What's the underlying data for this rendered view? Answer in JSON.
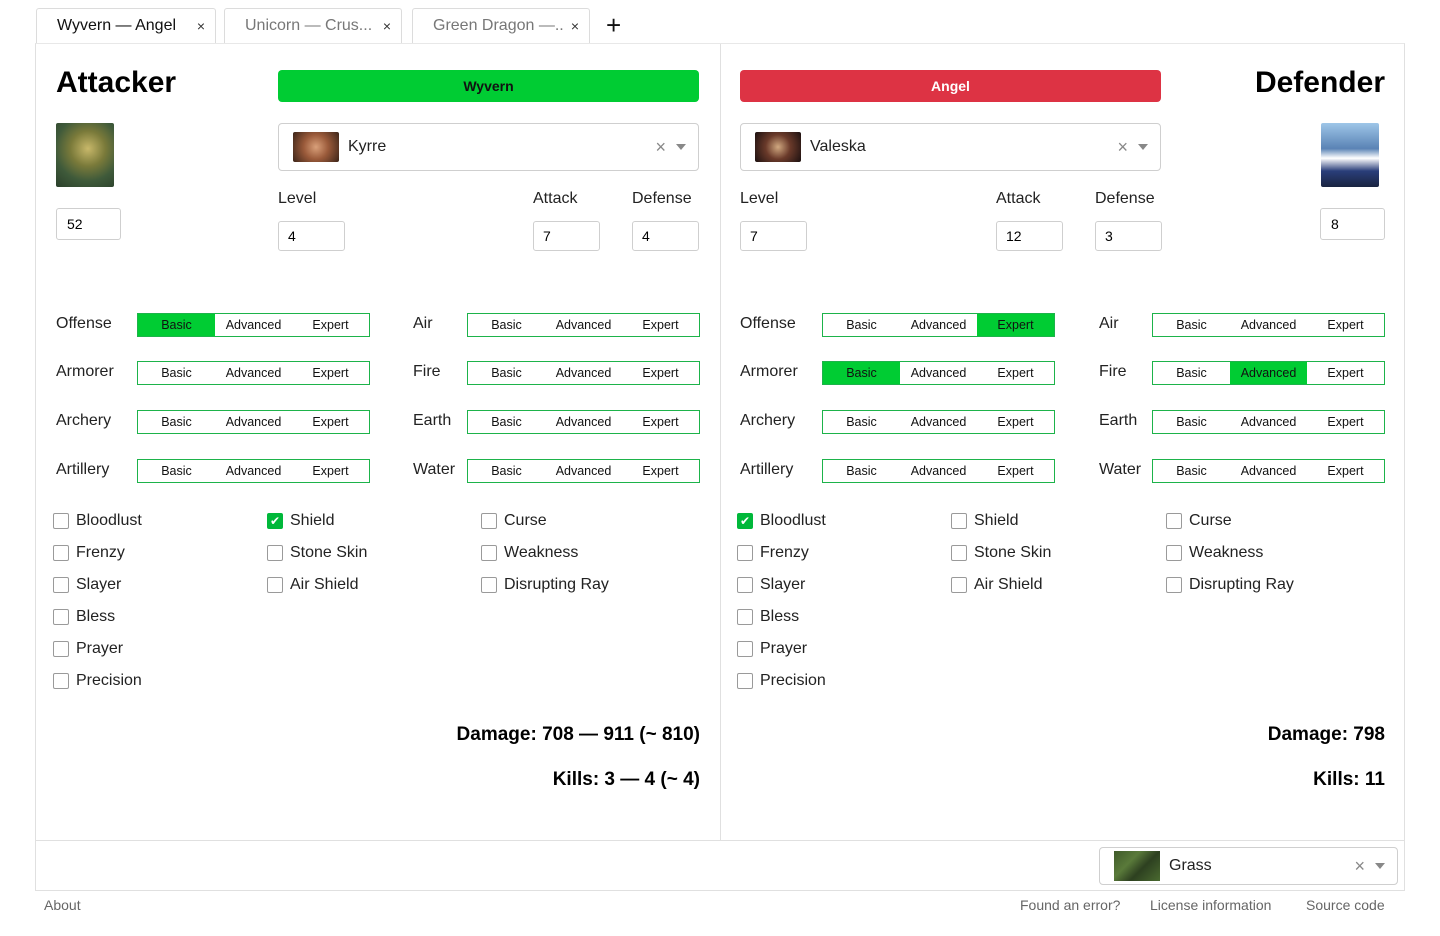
{
  "tabs": [
    {
      "label": "Wyvern — Angel",
      "active": true
    },
    {
      "label": "Unicorn — Crus...",
      "active": false
    },
    {
      "label": "Green Dragon —...",
      "active": false
    }
  ],
  "tab_close": "×",
  "tab_add": "+",
  "attacker": {
    "title": "Attacker",
    "creature": "Wyvern",
    "creature_color": "#00cc33",
    "portrait_icon": "wyvern-portrait",
    "count": "52",
    "hero": "Kyrre",
    "labels": {
      "level": "Level",
      "attack": "Attack",
      "defense": "Defense"
    },
    "level": "4",
    "attack": "7",
    "defense": "4",
    "skills": [
      {
        "name": "Offense",
        "selected": "Basic"
      },
      {
        "name": "Armorer",
        "selected": ""
      },
      {
        "name": "Archery",
        "selected": ""
      },
      {
        "name": "Artillery",
        "selected": ""
      }
    ],
    "magic": [
      {
        "name": "Air",
        "selected": ""
      },
      {
        "name": "Fire",
        "selected": ""
      },
      {
        "name": "Earth",
        "selected": ""
      },
      {
        "name": "Water",
        "selected": ""
      }
    ],
    "spells_col1": [
      {
        "name": "Bloodlust",
        "checked": false
      },
      {
        "name": "Frenzy",
        "checked": false
      },
      {
        "name": "Slayer",
        "checked": false
      },
      {
        "name": "Bless",
        "checked": false
      },
      {
        "name": "Prayer",
        "checked": false
      },
      {
        "name": "Precision",
        "checked": false
      }
    ],
    "spells_col2": [
      {
        "name": "Shield",
        "checked": true
      },
      {
        "name": "Stone Skin",
        "checked": false
      },
      {
        "name": "Air Shield",
        "checked": false
      }
    ],
    "spells_col3": [
      {
        "name": "Curse",
        "checked": false
      },
      {
        "name": "Weakness",
        "checked": false
      },
      {
        "name": "Disrupting Ray",
        "checked": false
      }
    ],
    "damage": "Damage: 708 — 911 (~ 810)",
    "kills": "Kills: 3 — 4 (~ 4)"
  },
  "defender": {
    "title": "Defender",
    "creature": "Angel",
    "creature_color": "#dd3344",
    "portrait_icon": "angel-portrait",
    "count": "8",
    "hero": "Valeska",
    "labels": {
      "level": "Level",
      "attack": "Attack",
      "defense": "Defense"
    },
    "level": "7",
    "attack": "12",
    "defense": "3",
    "skills": [
      {
        "name": "Offense",
        "selected": "Expert"
      },
      {
        "name": "Armorer",
        "selected": "Basic"
      },
      {
        "name": "Archery",
        "selected": ""
      },
      {
        "name": "Artillery",
        "selected": ""
      }
    ],
    "magic": [
      {
        "name": "Air",
        "selected": ""
      },
      {
        "name": "Fire",
        "selected": "Advanced"
      },
      {
        "name": "Earth",
        "selected": ""
      },
      {
        "name": "Water",
        "selected": ""
      }
    ],
    "spells_col1": [
      {
        "name": "Bloodlust",
        "checked": true
      },
      {
        "name": "Frenzy",
        "checked": false
      },
      {
        "name": "Slayer",
        "checked": false
      },
      {
        "name": "Bless",
        "checked": false
      },
      {
        "name": "Prayer",
        "checked": false
      },
      {
        "name": "Precision",
        "checked": false
      }
    ],
    "spells_col2": [
      {
        "name": "Shield",
        "checked": false
      },
      {
        "name": "Stone Skin",
        "checked": false
      },
      {
        "name": "Air Shield",
        "checked": false
      }
    ],
    "spells_col3": [
      {
        "name": "Curse",
        "checked": false
      },
      {
        "name": "Weakness",
        "checked": false
      },
      {
        "name": "Disrupting Ray",
        "checked": false
      }
    ],
    "damage": "Damage: 798",
    "kills": "Kills: 11"
  },
  "skill_levels": [
    "Basic",
    "Advanced",
    "Expert"
  ],
  "select_clear": "×",
  "terrain": "Grass",
  "footer": {
    "about": "About",
    "found_error": "Found an error?",
    "license": "License information",
    "source": "Source code"
  }
}
